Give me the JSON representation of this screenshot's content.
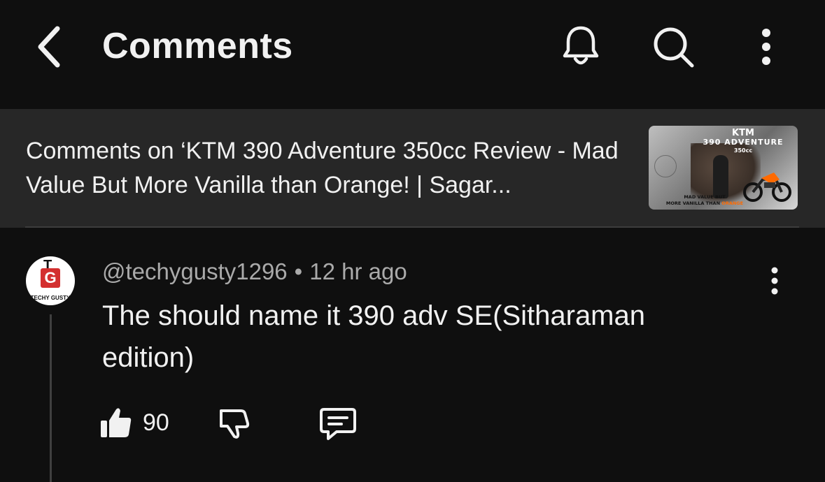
{
  "header": {
    "title": "Comments",
    "back_icon": "chevron-left-icon",
    "notification_icon": "bell-icon",
    "search_icon": "search-icon",
    "more_icon": "more-vertical-icon"
  },
  "video": {
    "banner_text": "Comments on ‘KTM 390 Adventure 350cc Review - Mad Value But More Vanilla than Orange! | Sagar...",
    "thumbnail": {
      "brand": "KTM",
      "model": "390 ADVENTURE",
      "cc": "350cc",
      "tagline_line1": "MAD VALUE BUT",
      "tagline_line2_prefix": "MORE VANILLA THAN",
      "tagline_line2_highlight": "ORANGE"
    }
  },
  "comment": {
    "avatar_letters_top": "T",
    "avatar_letters_main": "G",
    "avatar_tag": "TECHY GUSTY",
    "author": "@techygusty1296",
    "separator": "•",
    "time": "12 hr ago",
    "text": "The should name it 390 adv SE(Sitharaman edition)",
    "like_count": "90",
    "more_icon": "more-vertical-icon"
  },
  "colors": {
    "background": "#0f0f0f",
    "banner_bg": "#272727",
    "primary_text": "#f1f1f1",
    "secondary_text": "#aaaaaa",
    "avatar_accent": "#d32f2f"
  }
}
